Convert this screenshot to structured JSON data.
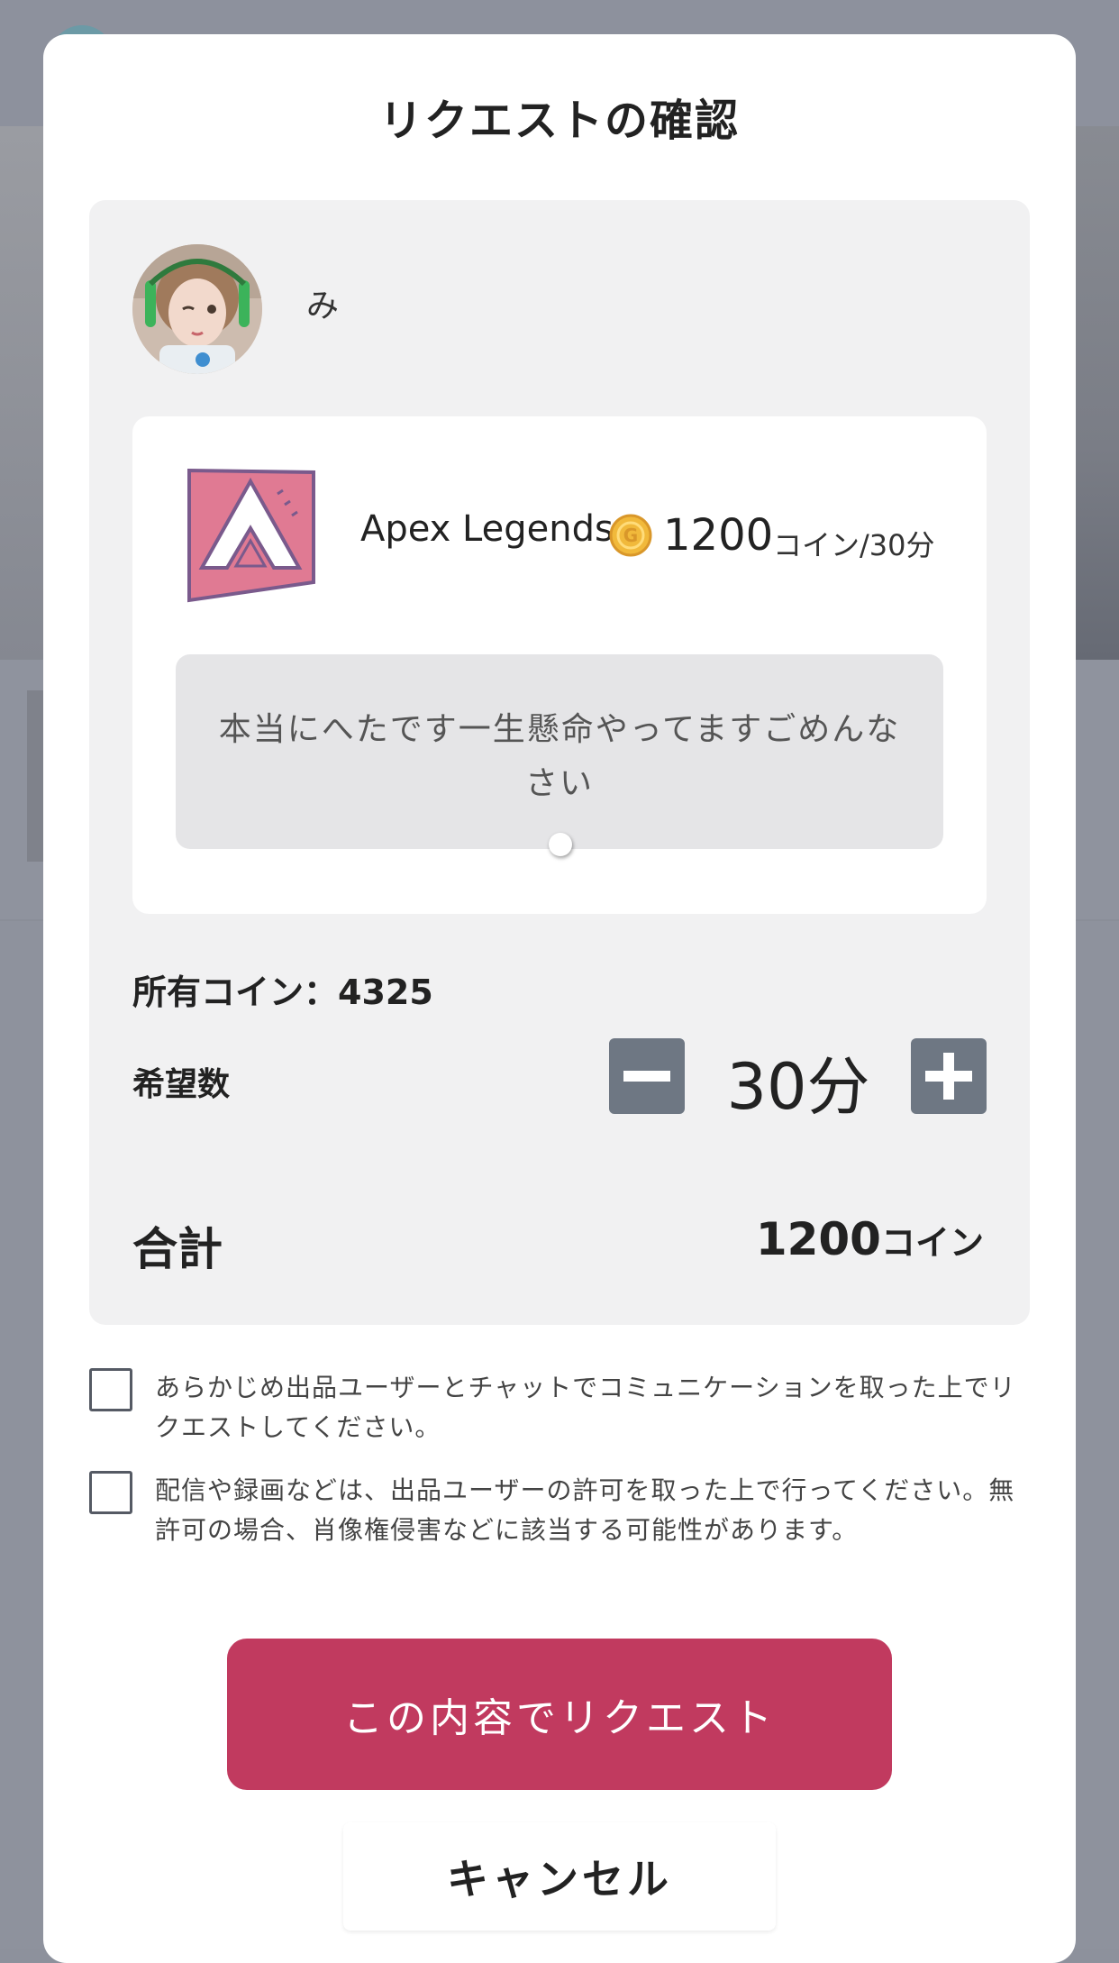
{
  "modal": {
    "title": "リクエストの確認"
  },
  "user": {
    "name": "み",
    "avatar_icon": "user-avatar-photo"
  },
  "product": {
    "game_name": "Apex Legends",
    "game_icon": "apex-legends-logo-icon",
    "coin_icon": "coin-icon",
    "price": "1200",
    "price_unit": "コイン/30分",
    "message": "本当にへたです一生懸命やってますごめんなさい"
  },
  "summary": {
    "owned_coins": "所有コイン：4325",
    "desired_label": "希望数",
    "quantity": "30分",
    "total_label": "合計",
    "total_value": "1200",
    "total_unit": "コイン"
  },
  "agreements": [
    {
      "text": "あらかじめ出品ユーザーとチャットでコミュニケーションを取った上でリクエストしてください。"
    },
    {
      "text": "配信や録画などは、出品ユーザーの許可を取った上で行ってください。無許可の場合、肖像権侵害などに該当する可能性があります。"
    }
  ],
  "actions": {
    "submit_label": "この内容でリクエスト",
    "cancel_label": "キャンセル"
  },
  "colors": {
    "accent": "#c13a5f",
    "stepper": "#6e7783",
    "game_icon_bg": "#e07a93",
    "game_icon_border": "#7a5a8c"
  }
}
